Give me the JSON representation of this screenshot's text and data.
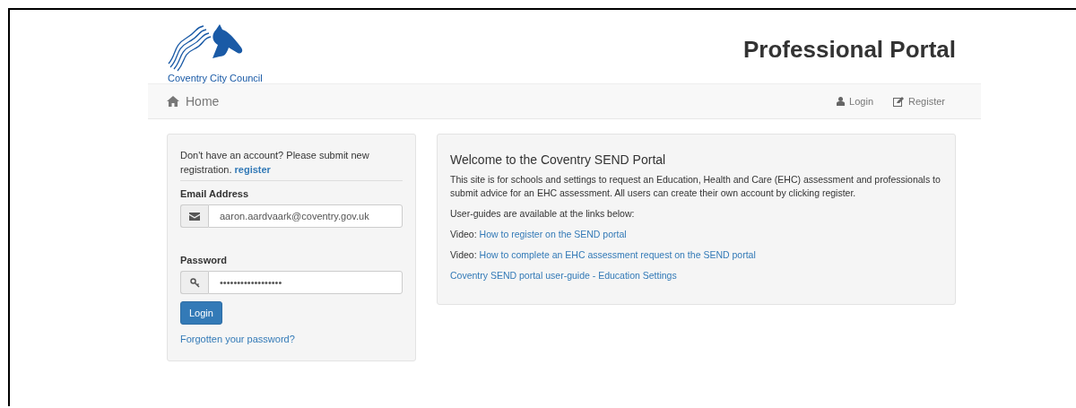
{
  "header": {
    "logo_text": "Coventry City Council",
    "title": "Professional Portal"
  },
  "navbar": {
    "home": "Home",
    "links": [
      {
        "kind": "user",
        "label": "Login"
      },
      {
        "kind": "edit",
        "label": "Register"
      }
    ]
  },
  "login": {
    "prompt": "Don't have an account? Please submit new registration.",
    "register_link": "register",
    "email_label": "Email Address",
    "email_value": "aaron.aardvaark@coventry.gov.uk",
    "password_label": "Password",
    "password_value": "••••••••••••••••••",
    "button": "Login",
    "forgot": "Forgotten your password?"
  },
  "welcome": {
    "heading": "Welcome to the Coventry SEND Portal",
    "intro": "This site is for schools and settings to request an Education, Health and Care (EHC) assessment and professionals to submit advice for an EHC assessment. All users can create their own account by clicking register.",
    "guides": "User-guides are available at the links below:",
    "links": [
      {
        "prefix": "Video:",
        "label": "How to register on the SEND portal"
      },
      {
        "prefix": "Video:",
        "label": "How to complete an EHC assessment request on the SEND portal"
      },
      {
        "label": "Coventry SEND portal user-guide - Education Settings"
      }
    ]
  }
}
